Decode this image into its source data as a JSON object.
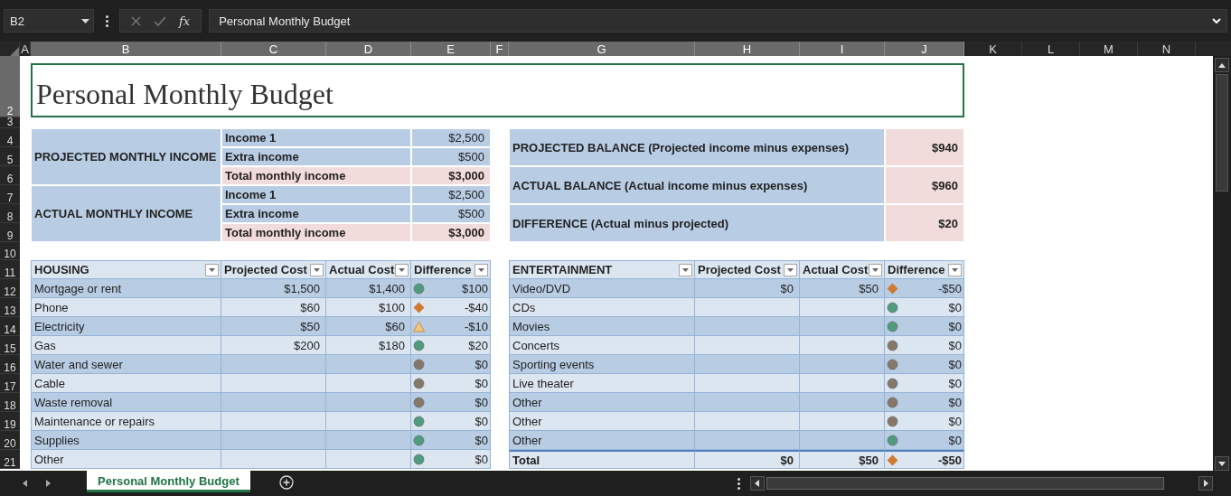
{
  "name_box": "B2",
  "function_button": "fx",
  "formula": "Personal Monthly Budget",
  "columns": [
    {
      "label": "A",
      "selected": false
    },
    {
      "label": "B",
      "selected": true
    },
    {
      "label": "C",
      "selected": true
    },
    {
      "label": "D",
      "selected": true
    },
    {
      "label": "E",
      "selected": true
    },
    {
      "label": "F",
      "selected": true
    },
    {
      "label": "G",
      "selected": true
    },
    {
      "label": "H",
      "selected": true
    },
    {
      "label": "I",
      "selected": true
    },
    {
      "label": "J",
      "selected": true
    },
    {
      "label": "K",
      "selected": false
    },
    {
      "label": "L",
      "selected": false
    },
    {
      "label": "M",
      "selected": false
    },
    {
      "label": "N",
      "selected": false
    }
  ],
  "rows": [
    {
      "label": "2",
      "selected": true
    },
    {
      "label": "3",
      "selected": false
    },
    {
      "label": "4",
      "selected": false
    },
    {
      "label": "5",
      "selected": false
    },
    {
      "label": "6",
      "selected": false
    },
    {
      "label": "7",
      "selected": false
    },
    {
      "label": "8",
      "selected": false
    },
    {
      "label": "9",
      "selected": false
    },
    {
      "label": "10",
      "selected": false
    },
    {
      "label": "11",
      "selected": false
    },
    {
      "label": "12",
      "selected": false
    },
    {
      "label": "13",
      "selected": false
    },
    {
      "label": "14",
      "selected": false
    },
    {
      "label": "15",
      "selected": false
    },
    {
      "label": "16",
      "selected": false
    },
    {
      "label": "17",
      "selected": false
    },
    {
      "label": "18",
      "selected": false
    },
    {
      "label": "19",
      "selected": false
    },
    {
      "label": "20",
      "selected": false
    },
    {
      "label": "21",
      "selected": false
    }
  ],
  "title": "Personal Monthly Budget",
  "income": [
    {
      "label": "PROJECTED MONTHLY INCOME",
      "lines": [
        {
          "label": "Income 1",
          "amount": "$2,500",
          "kind": "item"
        },
        {
          "label": "Extra income",
          "amount": "$500",
          "kind": "item"
        },
        {
          "label": "Total monthly income",
          "amount": "$3,000",
          "kind": "total"
        }
      ]
    },
    {
      "label": "ACTUAL MONTHLY INCOME",
      "lines": [
        {
          "label": "Income 1",
          "amount": "$2,500",
          "kind": "item"
        },
        {
          "label": "Extra income",
          "amount": "$500",
          "kind": "item"
        },
        {
          "label": "Total monthly income",
          "amount": "$3,000",
          "kind": "total"
        }
      ]
    }
  ],
  "balance": [
    {
      "label": "PROJECTED BALANCE (Projected income minus expenses)",
      "amount": "$940"
    },
    {
      "label": "ACTUAL BALANCE (Actual income minus expenses)",
      "amount": "$960"
    },
    {
      "label": "DIFFERENCE (Actual minus projected)",
      "amount": "$20"
    }
  ],
  "tables": [
    {
      "columns": [
        "HOUSING",
        "Projected Cost",
        "Actual Cost",
        "Difference"
      ],
      "rows": [
        {
          "kind": "item",
          "item": "Mortgage or rent",
          "projected": "$1,500",
          "actual": "$1,400",
          "indicator": {
            "kind": "circle",
            "color": "#4f9b7d"
          },
          "difference": "$100"
        },
        {
          "kind": "item",
          "item": "Phone",
          "projected": "$60",
          "actual": "$100",
          "indicator": {
            "kind": "diamond",
            "color": "#d07a30"
          },
          "difference": "-$40"
        },
        {
          "kind": "item",
          "item": "Electricity",
          "projected": "$50",
          "actual": "$60",
          "indicator": {
            "kind": "triangle",
            "color": "#f3c67c"
          },
          "difference": "-$10"
        },
        {
          "kind": "item",
          "item": "Gas",
          "projected": "$200",
          "actual": "$180",
          "indicator": {
            "kind": "circle",
            "color": "#4f9b7d"
          },
          "difference": "$20"
        },
        {
          "kind": "item",
          "item": "Water and sewer",
          "indicator": {
            "kind": "circle",
            "color": "#85786a"
          },
          "difference": "$0"
        },
        {
          "kind": "item",
          "item": "Cable",
          "indicator": {
            "kind": "circle",
            "color": "#85786a"
          },
          "difference": "$0"
        },
        {
          "kind": "item",
          "item": "Waste removal",
          "indicator": {
            "kind": "circle",
            "color": "#85786a"
          },
          "difference": "$0"
        },
        {
          "kind": "item",
          "item": "Maintenance or repairs",
          "indicator": {
            "kind": "circle",
            "color": "#4f9b7d"
          },
          "difference": "$0"
        },
        {
          "kind": "item",
          "item": "Supplies",
          "indicator": {
            "kind": "circle",
            "color": "#4f9b7d"
          },
          "difference": "$0"
        },
        {
          "kind": "item",
          "item": "Other",
          "indicator": {
            "kind": "circle",
            "color": "#4f9b7d"
          },
          "difference": "$0"
        }
      ]
    },
    {
      "columns": [
        "ENTERTAINMENT",
        "Projected Cost",
        "Actual Cost",
        "Difference"
      ],
      "rows": [
        {
          "kind": "item",
          "item": "Video/DVD",
          "projected": "$0",
          "actual": "$50",
          "indicator": {
            "kind": "diamond",
            "color": "#d07a30"
          },
          "difference": "-$50"
        },
        {
          "kind": "item",
          "item": "CDs",
          "indicator": {
            "kind": "circle",
            "color": "#4f9b7d"
          },
          "difference": "$0"
        },
        {
          "kind": "item",
          "item": "Movies",
          "indicator": {
            "kind": "circle",
            "color": "#4f9b7d"
          },
          "difference": "$0"
        },
        {
          "kind": "item",
          "item": "Concerts",
          "indicator": {
            "kind": "circle",
            "color": "#85786a"
          },
          "difference": "$0"
        },
        {
          "kind": "item",
          "item": "Sporting events",
          "indicator": {
            "kind": "circle",
            "color": "#85786a"
          },
          "difference": "$0"
        },
        {
          "kind": "item",
          "item": "Live theater",
          "indicator": {
            "kind": "circle",
            "color": "#85786a"
          },
          "difference": "$0"
        },
        {
          "kind": "item",
          "item": "Other",
          "indicator": {
            "kind": "circle",
            "color": "#85786a"
          },
          "difference": "$0"
        },
        {
          "kind": "item",
          "item": "Other",
          "indicator": {
            "kind": "circle",
            "color": "#85786a"
          },
          "difference": "$0"
        },
        {
          "kind": "item",
          "item": "Other",
          "indicator": {
            "kind": "circle",
            "color": "#4f9b7d"
          },
          "difference": "$0"
        },
        {
          "kind": "total",
          "item": "Total",
          "projected": "$0",
          "actual": "$50",
          "indicator": {
            "kind": "diamond",
            "color": "#d07a30"
          },
          "difference": "-$50"
        }
      ]
    }
  ],
  "sheet_tabs": [
    {
      "label": "Personal Monthly Budget",
      "selected": true
    }
  ]
}
